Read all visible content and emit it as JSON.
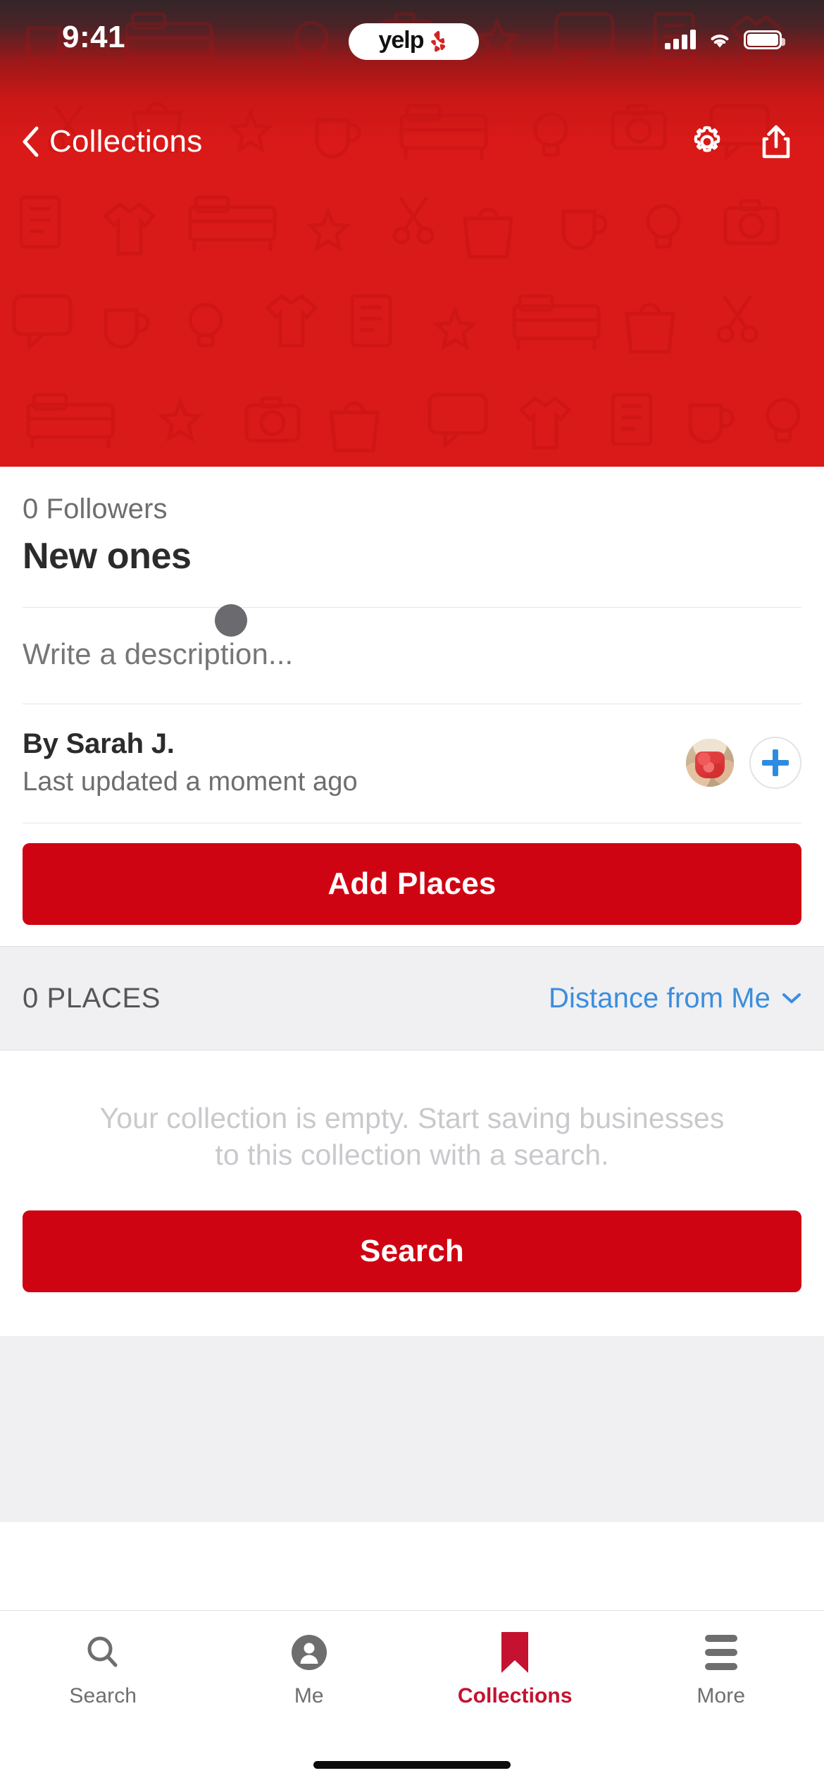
{
  "status_bar": {
    "time": "9:41",
    "app_name": "yelp",
    "signal_icon": "cellular-signal-icon",
    "wifi_icon": "wifi-icon",
    "battery_icon": "battery-icon"
  },
  "nav": {
    "back_icon": "chevron-left-icon",
    "title": "Collections",
    "settings_icon": "gear-icon",
    "share_icon": "share-icon"
  },
  "collection": {
    "followers": "0 Followers",
    "title": "New ones",
    "description_placeholder": "Write a description...",
    "author": "By Sarah J.",
    "updated": "Last updated a moment ago",
    "avatar_name": "avatar",
    "add_collaborator_icon": "plus-icon"
  },
  "actions": {
    "add_places_label": "Add Places",
    "search_label": "Search"
  },
  "places": {
    "count_label": "0 PLACES",
    "sort_label": "Distance from Me",
    "sort_chevron_icon": "chevron-down-icon"
  },
  "empty_state": {
    "line1": "Your collection is empty. Start saving businesses",
    "line2": "to this collection with a search."
  },
  "tabs": [
    {
      "label": "Search",
      "icon": "search-icon",
      "active": false
    },
    {
      "label": "Me",
      "icon": "person-circle-icon",
      "active": false
    },
    {
      "label": "Collections",
      "icon": "bookmark-icon",
      "active": true
    },
    {
      "label": "More",
      "icon": "hamburger-menu-icon",
      "active": false
    }
  ],
  "colors": {
    "brand_red": "#d91a18",
    "button_red": "#cf0412",
    "active_tab_red": "#c41230",
    "link_blue": "#3a8ede",
    "plus_blue": "#2d8ce0",
    "gray_bg": "#f0eff1",
    "muted_text": "#6e6e6e",
    "empty_text": "#c9c9cd"
  }
}
